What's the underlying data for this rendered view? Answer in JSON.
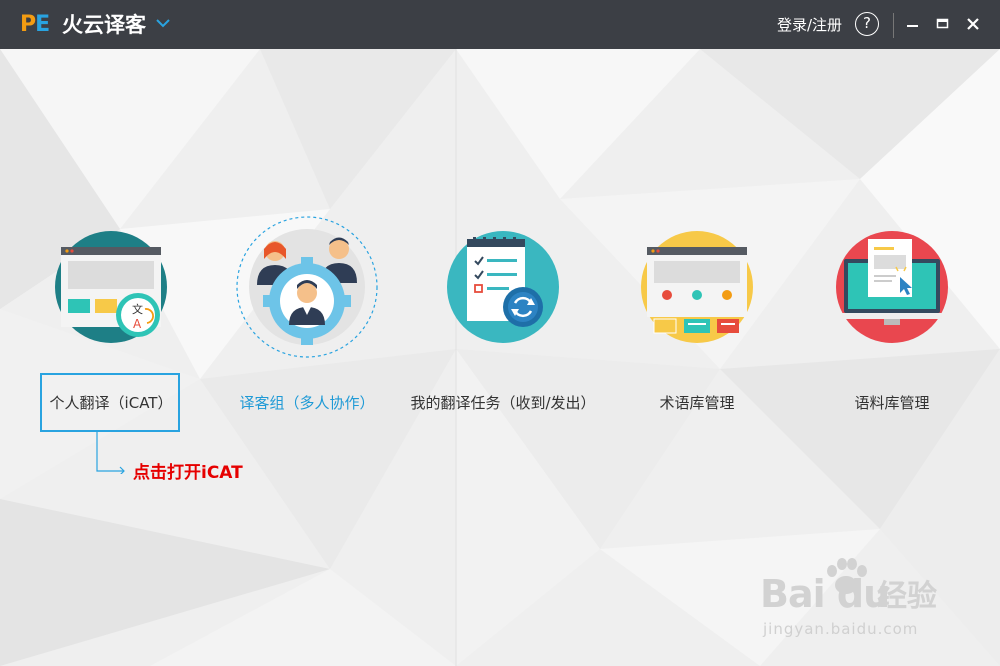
{
  "app": {
    "logo_p": "P",
    "logo_e": "E",
    "title": "火云译客"
  },
  "header": {
    "login_label": "登录/注册",
    "help_glyph": "?"
  },
  "features": [
    {
      "label": "个人翻译（iCAT）",
      "icon": "translate-window-icon",
      "active": false
    },
    {
      "label": "译客组（多人协作）",
      "icon": "team-gear-icon",
      "active": true
    },
    {
      "label": "我的翻译任务（收到/发出）",
      "icon": "task-checklist-icon",
      "active": false
    },
    {
      "label": "术语库管理",
      "icon": "term-base-icon",
      "active": false
    },
    {
      "label": "语料库管理",
      "icon": "corpus-monitor-icon",
      "active": false
    }
  ],
  "icon_glyphs": {
    "wen": "文",
    "a": "A"
  },
  "annotation": {
    "callout": "点击打开iCAT"
  },
  "watermark": {
    "brand": "Bai  du",
    "sub": "经验",
    "url": "jingyan.baidu.com"
  },
  "colors": {
    "titlebar": "#3c3f45",
    "accent_blue": "#1f9ad6",
    "logo_orange": "#f39c12",
    "callout_red": "#e60000"
  }
}
